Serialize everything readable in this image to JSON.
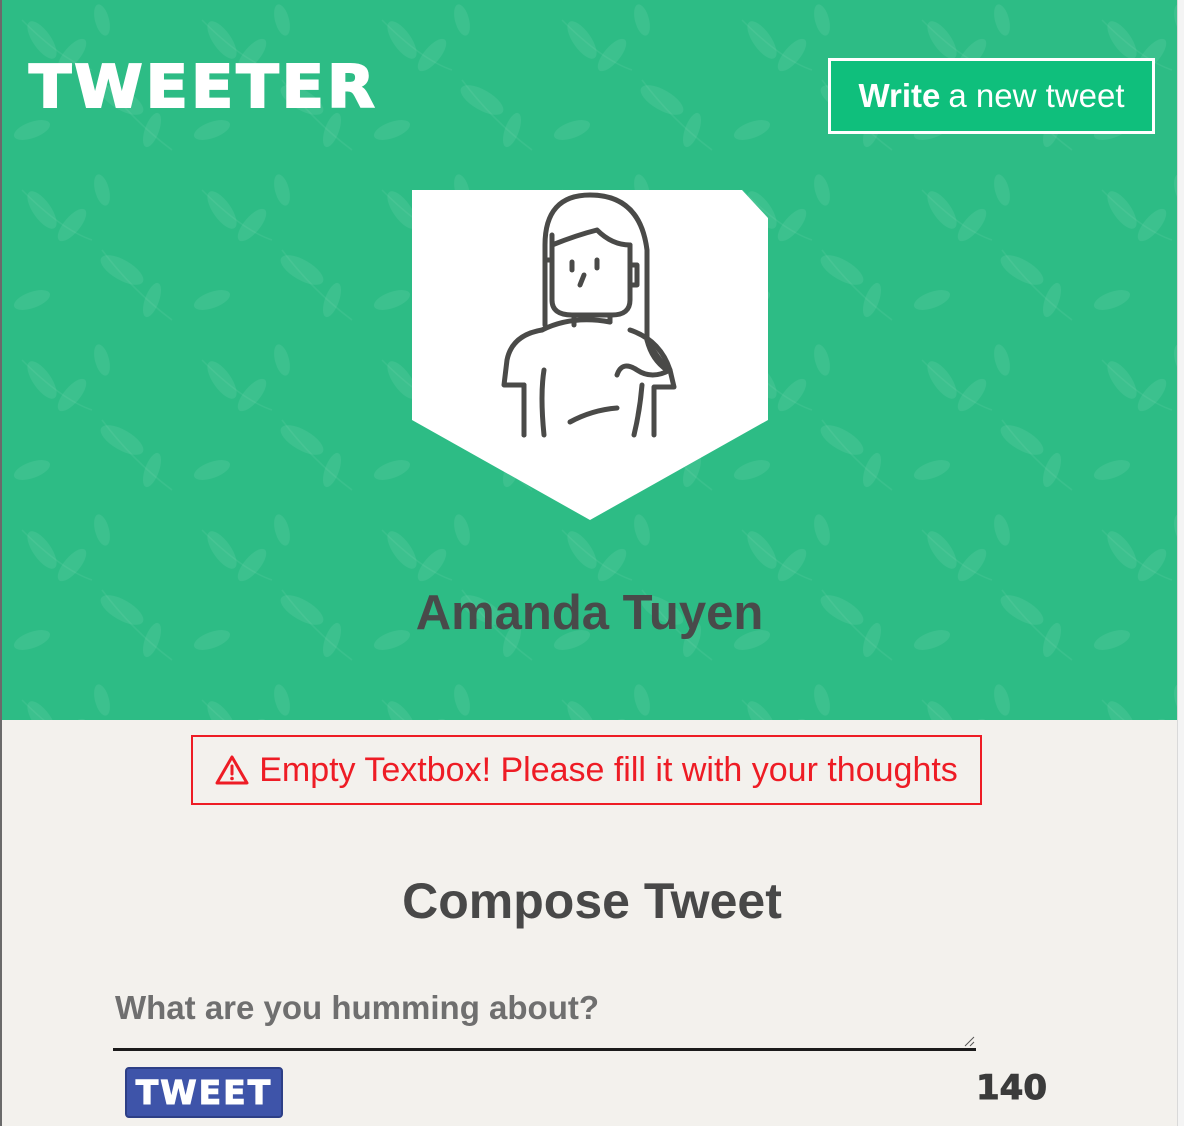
{
  "app": {
    "logo": "TWEETER",
    "write_button": {
      "bold_label": "Write",
      "rest_label": "a new tweet"
    }
  },
  "profile": {
    "name": "Amanda Tuyen",
    "avatar_icon": "woman-avatar-icon"
  },
  "error": {
    "icon": "warning-icon",
    "message": "Empty Textbox! Please fill it with your thoughts"
  },
  "compose": {
    "title": "Compose Tweet",
    "placeholder": "What are you humming about?",
    "value": "",
    "submit_label": "TWEET",
    "char_counter": "140"
  },
  "colors": {
    "hero_bg": "#2dbc85",
    "write_button_bg": "#0fbf7c",
    "error_red": "#ee1c25",
    "tweet_button_bg": "#3e54a9",
    "page_bg": "#f3f1ed"
  }
}
